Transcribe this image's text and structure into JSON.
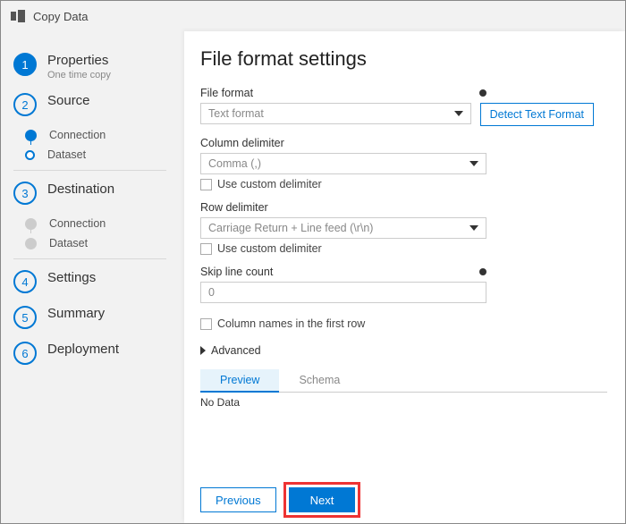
{
  "app": {
    "title": "Copy Data"
  },
  "sidebar": {
    "steps": [
      {
        "num": "1",
        "label": "Properties",
        "sub": "One time copy"
      },
      {
        "num": "2",
        "label": "Source",
        "children": [
          {
            "label": "Connection"
          },
          {
            "label": "Dataset"
          }
        ]
      },
      {
        "num": "3",
        "label": "Destination",
        "children": [
          {
            "label": "Connection"
          },
          {
            "label": "Dataset"
          }
        ]
      },
      {
        "num": "4",
        "label": "Settings"
      },
      {
        "num": "5",
        "label": "Summary"
      },
      {
        "num": "6",
        "label": "Deployment"
      }
    ]
  },
  "main": {
    "title": "File format settings",
    "fileFormat": {
      "label": "File format",
      "value": "Text format"
    },
    "detectButton": "Detect Text Format",
    "columnDelimiter": {
      "label": "Column delimiter",
      "value": "Comma (,)",
      "customLabel": "Use custom delimiter"
    },
    "rowDelimiter": {
      "label": "Row delimiter",
      "value": "Carriage Return + Line feed (\\r\\n)",
      "customLabel": "Use custom delimiter"
    },
    "skipLine": {
      "label": "Skip line count",
      "value": "0"
    },
    "firstRow": {
      "label": "Column names in the first row"
    },
    "advanced": "Advanced",
    "tabs": {
      "preview": "Preview",
      "schema": "Schema"
    },
    "noData": "No Data",
    "prev": "Previous",
    "next": "Next"
  }
}
